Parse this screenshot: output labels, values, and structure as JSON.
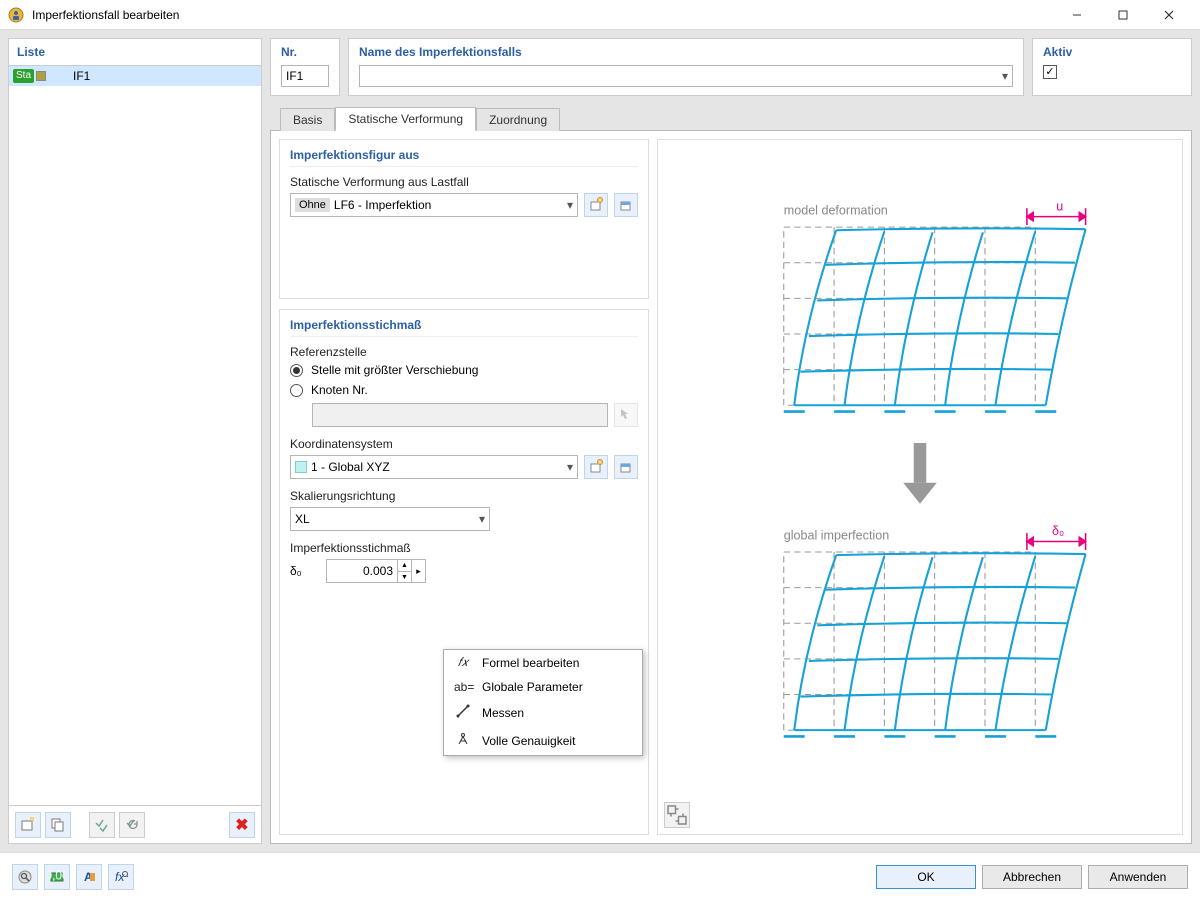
{
  "window": {
    "title": "Imperfektionsfall bearbeiten"
  },
  "leftpanel": {
    "header": "Liste",
    "rows": [
      {
        "tag": "Sta",
        "name": "IF1"
      }
    ]
  },
  "header": {
    "nr_label": "Nr.",
    "nr_value": "IF1",
    "name_label": "Name des Imperfektionsfalls",
    "name_value": "",
    "aktiv_label": "Aktiv",
    "aktiv_checked": true
  },
  "tabs": {
    "items": [
      {
        "label": "Basis",
        "active": false
      },
      {
        "label": "Statische Verformung",
        "active": true
      },
      {
        "label": "Zuordnung",
        "active": false
      }
    ]
  },
  "section1": {
    "title": "Imperfektionsfigur aus",
    "loadcase_label": "Statische Verformung aus Lastfall",
    "loadcase_prefix": "Ohne",
    "loadcase_value": "LF6 - Imperfektion"
  },
  "section2": {
    "title": "Imperfektionsstichmaß",
    "ref_label": "Referenzstelle",
    "radio1": "Stelle mit größter Verschiebung",
    "radio2": "Knoten Nr.",
    "csys_label": "Koordinatensystem",
    "csys_value": "1 - Global XYZ",
    "scale_label": "Skalierungsrichtung",
    "scale_value": "XL",
    "delta_label": "Imperfektionsstichmaß",
    "delta_symbol": "δ₀",
    "delta_value": "0.003"
  },
  "contextmenu": {
    "items": [
      {
        "icon": "𝑓𝑥",
        "label": "Formel bearbeiten"
      },
      {
        "icon": "ab=",
        "label": "Globale Parameter"
      },
      {
        "icon": "📐",
        "label": "Messen"
      },
      {
        "icon": "Å",
        "label": "Volle Genauigkeit"
      }
    ]
  },
  "preview": {
    "top_label": "model deformation",
    "top_sym": "u",
    "bottom_label": "global imperfection",
    "bottom_sym": "δ₀"
  },
  "buttons": {
    "ok": "OK",
    "cancel": "Abbrechen",
    "apply": "Anwenden"
  }
}
